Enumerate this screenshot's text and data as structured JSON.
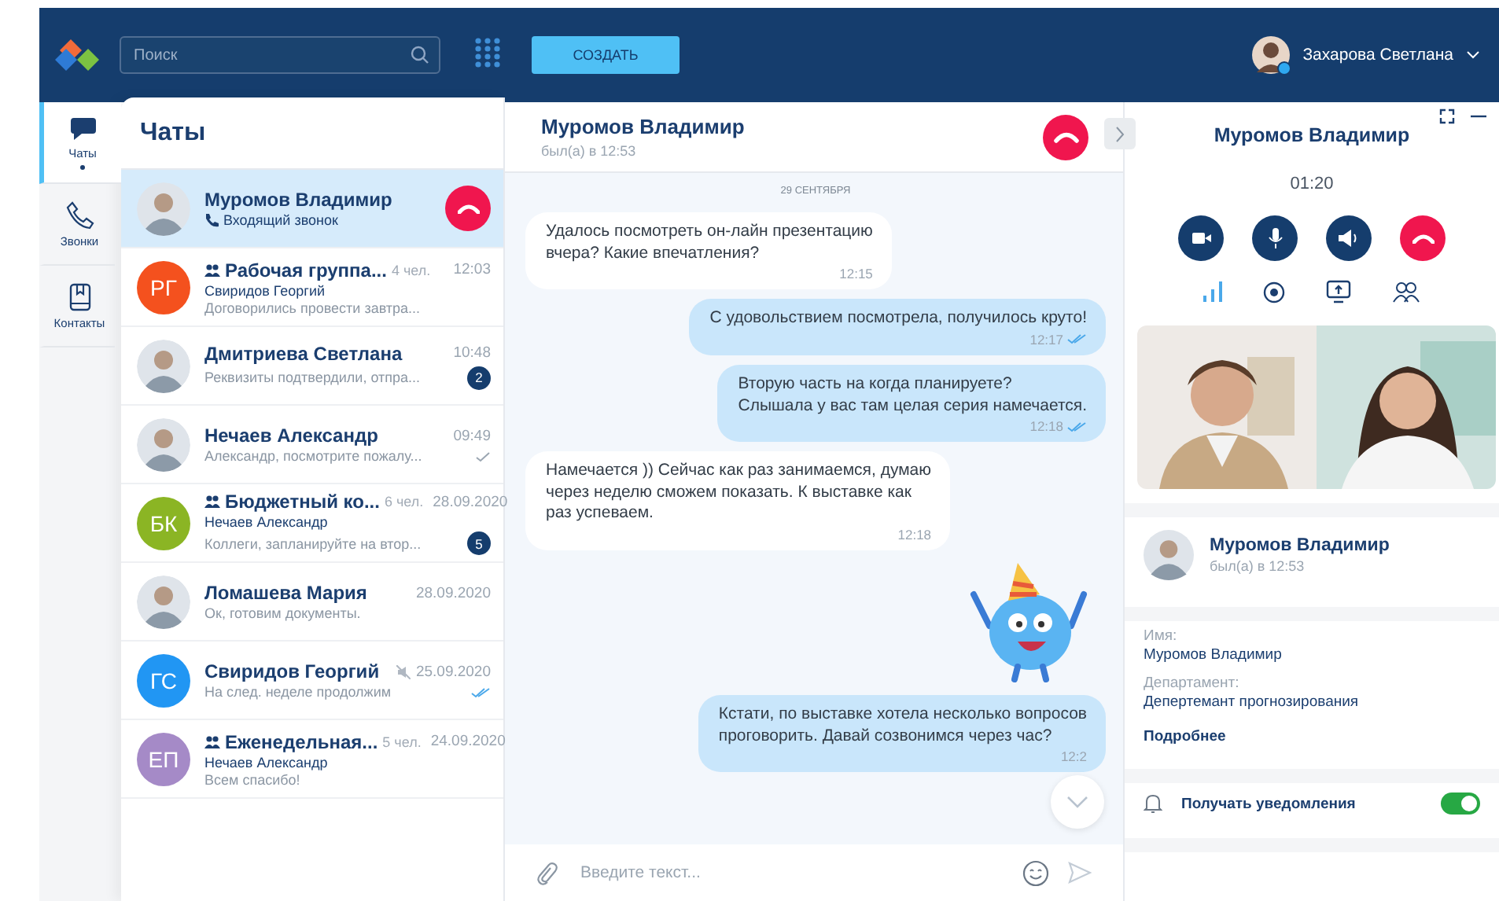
{
  "header": {
    "search": {
      "placeholder": "Поиск"
    },
    "create_button": "СОЗДАТЬ",
    "user": {
      "name": "Захарова Светлана",
      "online": true
    }
  },
  "nav": [
    {
      "label": "Чаты",
      "selected": true
    },
    {
      "label": "Звонки",
      "selected": false
    },
    {
      "label": "Контакты",
      "selected": false
    }
  ],
  "chat_list": {
    "title": "Чаты",
    "items": [
      {
        "kind": "call",
        "name": "Муромов Владимир",
        "preview": "Входящий звонок",
        "selected": true,
        "group": false,
        "muted": false
      },
      {
        "kind": "chat",
        "initials": "РГ",
        "color": "#f4511e",
        "name": "Рабочая группа...",
        "members": "4 чел.",
        "time": "12:03",
        "sender": "Свиридов Георгий",
        "preview": "Договорились провести завтра...",
        "selected": false,
        "group": true,
        "muted": false
      },
      {
        "kind": "chat",
        "name": "Дмитриева Светлана",
        "time": "10:48",
        "preview": "Реквизиты подтвердили, отпра...",
        "unread": "2",
        "selected": false,
        "group": false,
        "muted": false
      },
      {
        "kind": "chat",
        "name": "Нечаев Александр",
        "time": "09:49",
        "preview": "Александр, посмотрите пожалу...",
        "read": false,
        "selected": false,
        "group": false,
        "muted": false
      },
      {
        "kind": "chat",
        "initials": "БК",
        "color": "#8bb524",
        "name": "Бюджетный ко...",
        "members": "6 чел.",
        "time": "28.09.2020",
        "sender": "Нечаев Александр",
        "preview": "Коллеги, запланируйте на втор...",
        "unread": "5",
        "selected": false,
        "group": true,
        "muted": false
      },
      {
        "kind": "chat",
        "name": "Ломашева Мария",
        "time": "28.09.2020",
        "preview": "Ок, готовим документы.",
        "selected": false,
        "group": false,
        "muted": false
      },
      {
        "kind": "chat",
        "initials": "ГС",
        "color": "#2196f3",
        "name": "Свиридов Георгий",
        "time": "25.09.2020",
        "preview": "На след. неделе продолжим",
        "read": true,
        "selected": false,
        "group": false,
        "muted": true
      },
      {
        "kind": "chat",
        "initials": "ЕП",
        "color": "#a58ac7",
        "name": "Еженедельная...",
        "members": "5 чел.",
        "time": "24.09.2020",
        "sender": "Нечаев Александр",
        "preview": "Всем спасибо!",
        "selected": false,
        "group": true,
        "muted": false
      }
    ]
  },
  "chat": {
    "name": "Муромов Владимир",
    "status": "был(а) в 12:53",
    "date": "29 СЕНТЯБРЯ",
    "messages": [
      {
        "kind": "in",
        "text": "Удалось посмотреть он-лайн презентацию\nвчера? Какие впечатления?",
        "time": "12:15"
      },
      {
        "kind": "out",
        "text": "С удовольствием посмотрела, получилось круто!",
        "time": "12:17",
        "read": true
      },
      {
        "kind": "out",
        "text": "Вторую часть на когда планируете?\nСлышала у вас там целая серия намечается.",
        "time": "12:18",
        "read": true
      },
      {
        "kind": "in",
        "text": "Намечается )) Сейчас как раз занимаемся, думаю\nчерез неделю сможем показать. К выставке как\nраз успеваем.",
        "time": "12:18"
      },
      {
        "kind": "sticker"
      },
      {
        "kind": "out",
        "text": "Кстати, по выставке хотела несколько вопросов\nпроговорить. Давай созвонимся через час?",
        "time": "12:2"
      }
    ],
    "input": {
      "placeholder": "Введите текст..."
    }
  },
  "call_panel": {
    "name": "Муромов Владимир",
    "timer": "01:20",
    "contact": {
      "name": "Муромов Владимир",
      "status": "был(а) в 12:53"
    },
    "fields": [
      {
        "label": "Имя:",
        "value": "Муромов Владимир"
      },
      {
        "label": "Департамент:",
        "value": "Депертемант прогнозирования"
      }
    ],
    "more_link": "Подробнее",
    "notifications": {
      "label": "Получать уведомления",
      "on": true
    }
  }
}
